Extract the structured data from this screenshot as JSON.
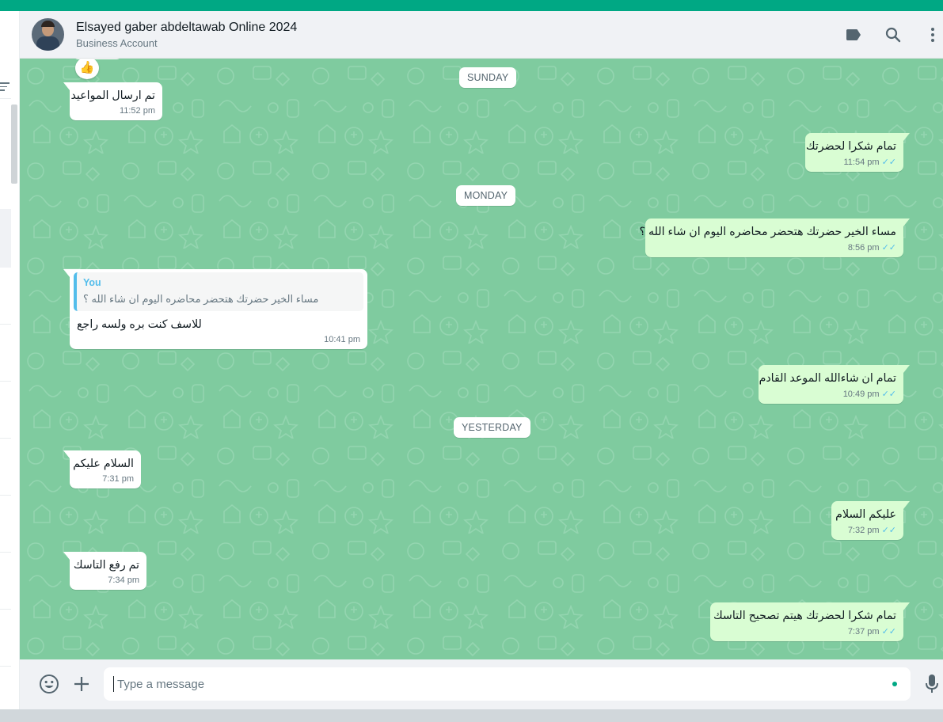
{
  "header": {
    "contact_name": "Elsayed gaber abdeltawab Online 2024",
    "contact_subtitle": "Business Account",
    "icons": [
      "label-icon",
      "search-icon",
      "menu-icon"
    ]
  },
  "dates": {
    "sunday": "SUNDAY",
    "monday": "MONDAY",
    "yesterday": "YESTERDAY"
  },
  "messages": {
    "m1": {
      "direction": "in",
      "reaction": "👍",
      "text": "تم ارسال المواعيد",
      "time": "11:52 pm"
    },
    "m2": {
      "direction": "out",
      "text": "تمام شكرا لحضرتك",
      "time": "11:54 pm",
      "status": "read"
    },
    "m3": {
      "direction": "out",
      "text": "مساء الخير حضرتك هتحضر محاضره اليوم ان شاء الله ؟",
      "time": "8:56 pm",
      "status": "read"
    },
    "m4": {
      "direction": "in",
      "quote_author": "You",
      "quote_text": "مساء الخير حضرتك هتحضر محاضره اليوم ان شاء الله ؟",
      "text": "للاسف كنت بره ولسه راجع",
      "time": "10:41 pm"
    },
    "m5": {
      "direction": "out",
      "text": "تمام ان شاءالله الموعد القادم",
      "time": "10:49 pm",
      "status": "read"
    },
    "m6": {
      "direction": "in",
      "text": "السلام عليكم",
      "time": "7:31 pm"
    },
    "m7": {
      "direction": "out",
      "text": "عليكم السلام",
      "time": "7:32 pm",
      "status": "read"
    },
    "m8": {
      "direction": "in",
      "text": "تم رفع التاسك",
      "time": "7:34 pm"
    },
    "m9": {
      "direction": "out",
      "text": "تمام شكرا لحضرتك هيتم تصحيح التاسك",
      "time": "7:37 pm",
      "status": "read"
    }
  },
  "composer": {
    "placeholder": "Type a message",
    "icons": [
      "emoji-icon",
      "attach-plus-icon",
      "microphone-icon"
    ]
  },
  "colors": {
    "accent": "#00a884",
    "chat_bg": "#7fcb9f",
    "outgoing_bubble": "#d9fdd3",
    "incoming_bubble": "#ffffff",
    "read_tick": "#53bdeb"
  }
}
